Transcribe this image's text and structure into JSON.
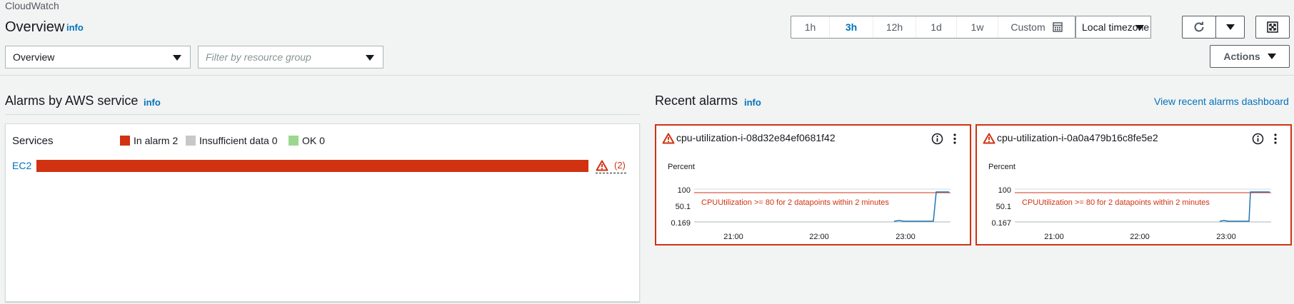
{
  "header": {
    "breadcrumb": "CloudWatch",
    "title": "Overview",
    "info": "info",
    "time_ranges": [
      "1h",
      "3h",
      "12h",
      "1d",
      "1w"
    ],
    "active_range": "3h",
    "custom_label": "Custom",
    "timezone": "Local timezone",
    "view_select": "Overview",
    "filter_placeholder": "Filter by resource group",
    "actions_label": "Actions"
  },
  "alarms_by_service": {
    "title": "Alarms by AWS service",
    "info": "info",
    "services_label": "Services",
    "legend": [
      {
        "label": "In alarm 2",
        "color": "#d13212"
      },
      {
        "label": "Insufficient data 0",
        "color": "#c8c8c8"
      },
      {
        "label": "OK 0",
        "color": "#9bd88e"
      }
    ],
    "rows": [
      {
        "service": "EC2",
        "count_label": "(2)",
        "in_alarm": 2
      }
    ]
  },
  "recent_alarms": {
    "title": "Recent alarms",
    "info": "info",
    "view_dashboard_link": "View recent alarms dashboard",
    "cards": [
      {
        "name": "cpu-utilization-i-08d32e84ef0681f42",
        "unit": "Percent",
        "threshold_text": "CPUUtilization >= 80 for 2 datapoints within 2 minutes",
        "ticks": [
          "100",
          "50.1",
          "0.169"
        ],
        "x_ticks": [
          "21:00",
          "22:00",
          "23:00"
        ]
      },
      {
        "name": "cpu-utilization-i-0a0a479b16c8fe5e2",
        "unit": "Percent",
        "threshold_text": "CPUUtilization >= 80 for 2 datapoints within 2 minutes",
        "ticks": [
          "100",
          "50.1",
          "0.167"
        ],
        "x_ticks": [
          "21:00",
          "22:00",
          "23:00"
        ]
      }
    ]
  },
  "colors": {
    "alarm": "#d13212",
    "link": "#0073bb",
    "series": "#1f77b4"
  }
}
